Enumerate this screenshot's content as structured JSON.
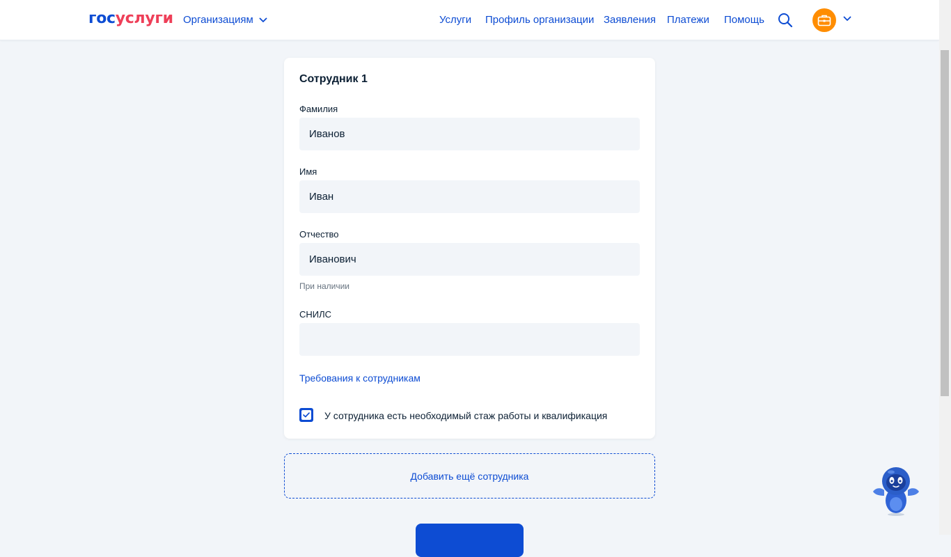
{
  "header": {
    "logo": {
      "part1": "гос",
      "part2": "услуги"
    },
    "org_menu_label": "Организациям",
    "nav": [
      {
        "id": "services",
        "label": "Услуги"
      },
      {
        "id": "org-profile",
        "label": "Профиль организации"
      },
      {
        "id": "applications",
        "label": "Заявления"
      },
      {
        "id": "payments",
        "label": "Платежи"
      },
      {
        "id": "help",
        "label": "Помощь"
      }
    ],
    "icons": {
      "search": "search-icon",
      "avatar": "briefcase-icon",
      "menu": "chevron-down-icon"
    }
  },
  "form": {
    "title": "Сотрудник 1",
    "fields": {
      "last_name": {
        "label": "Фамилия",
        "value": "Иванов"
      },
      "first_name": {
        "label": "Имя",
        "value": "Иван"
      },
      "patronymic": {
        "label": "Отчество",
        "value": "Иванович",
        "hint": "При наличии"
      },
      "snils": {
        "label": "СНИЛС",
        "value": ""
      }
    },
    "requirements_link": "Требования к сотрудникам",
    "qualification_checkbox": {
      "label": "У сотрудника есть необходимый стаж работы и квалификация",
      "checked": true
    }
  },
  "add_employee_label": "Добавить ещё сотрудника",
  "colors": {
    "accent": "#0d4cd3",
    "logo_red": "#ee3f58",
    "avatar": "#ff8d00",
    "page_bg": "#f2f5f9",
    "input_bg": "#f2f5f9"
  }
}
